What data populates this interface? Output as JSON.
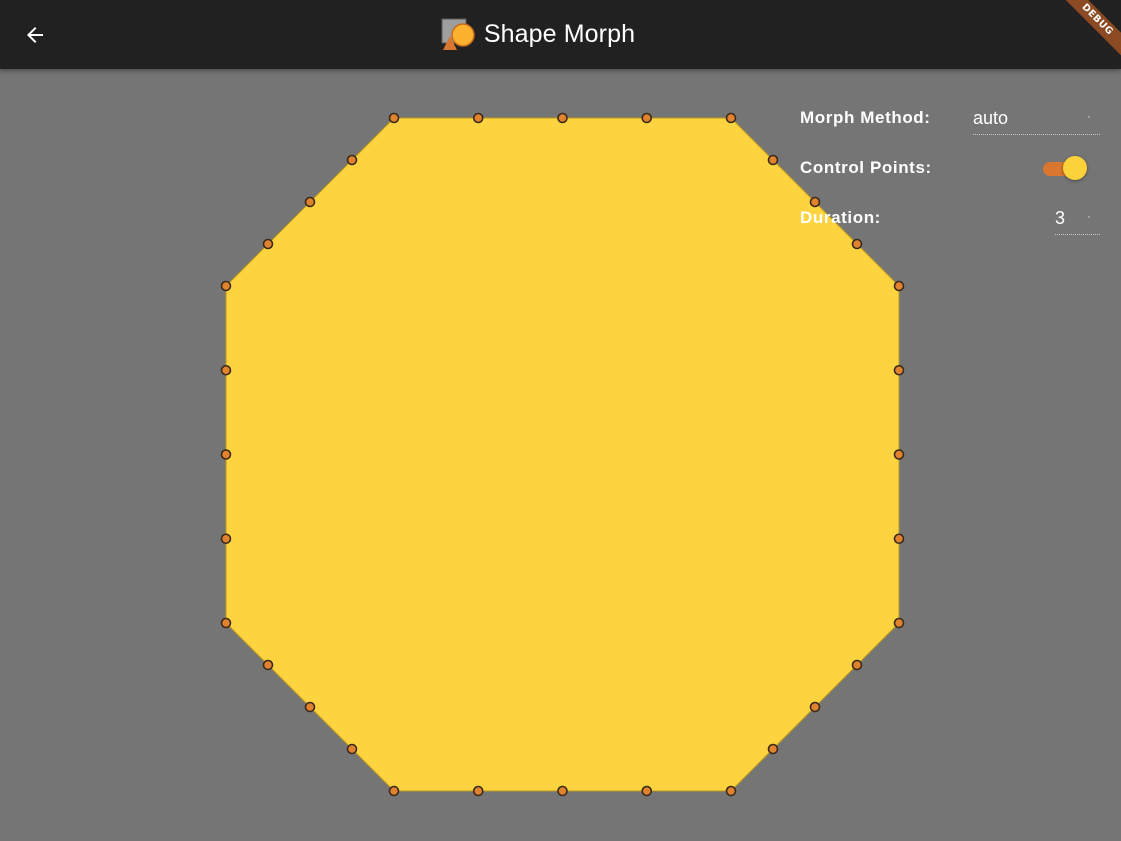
{
  "appbar": {
    "title": "Shape Morph",
    "back_icon": "arrow-back-icon",
    "logo_icon": "shape-morph-logo-icon"
  },
  "debug_banner": {
    "label": "DEBUG"
  },
  "controls": {
    "morph_method": {
      "label": "Morph Method:",
      "value": "auto"
    },
    "control_points": {
      "label": "Control Points:",
      "enabled": true
    },
    "duration": {
      "label": "Duration:",
      "value": "3"
    }
  },
  "colors": {
    "appbar_bg": "#212121",
    "canvas_bg": "#757575",
    "shape_fill": "#fdd43f",
    "control_point_fill": "#e0822e",
    "control_point_stroke": "#3a2a1a",
    "accent": "#d9772f",
    "debug_ribbon": "#8b4a22"
  },
  "shape": {
    "kind": "octagon",
    "control_point_count": 32
  }
}
